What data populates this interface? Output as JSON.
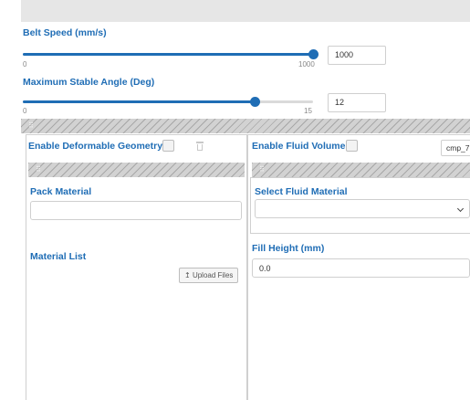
{
  "belt_speed": {
    "label": "Belt Speed (mm/s)",
    "min_label": "0",
    "max_label": "1000",
    "value": "1000",
    "min": 0,
    "max": 1000,
    "current": 1000
  },
  "max_angle": {
    "label": "Maximum Stable Angle (Deg)",
    "min_label": "0",
    "max_label": "15",
    "value": "12",
    "min": 0,
    "max": 15,
    "current": 12
  },
  "pack": {
    "enable_label": "Enable Deformable Geometry",
    "material_label": "Pack Material",
    "material_value": "",
    "list_label": "Material List",
    "upload_label": "Upload Files",
    "upload_icon": "↥"
  },
  "fluid": {
    "enable_label": "Enable Fluid Volume",
    "component_id": "cmp_7",
    "select_label": "Select Fluid Material",
    "select_value": "",
    "fill_label": "Fill Height (mm)",
    "fill_value": "0.0"
  },
  "grip_glyph": "⠿",
  "colors": {
    "accent": "#1f6db5",
    "header_bar": "#e6e6e6",
    "border": "#cfcfcf"
  }
}
